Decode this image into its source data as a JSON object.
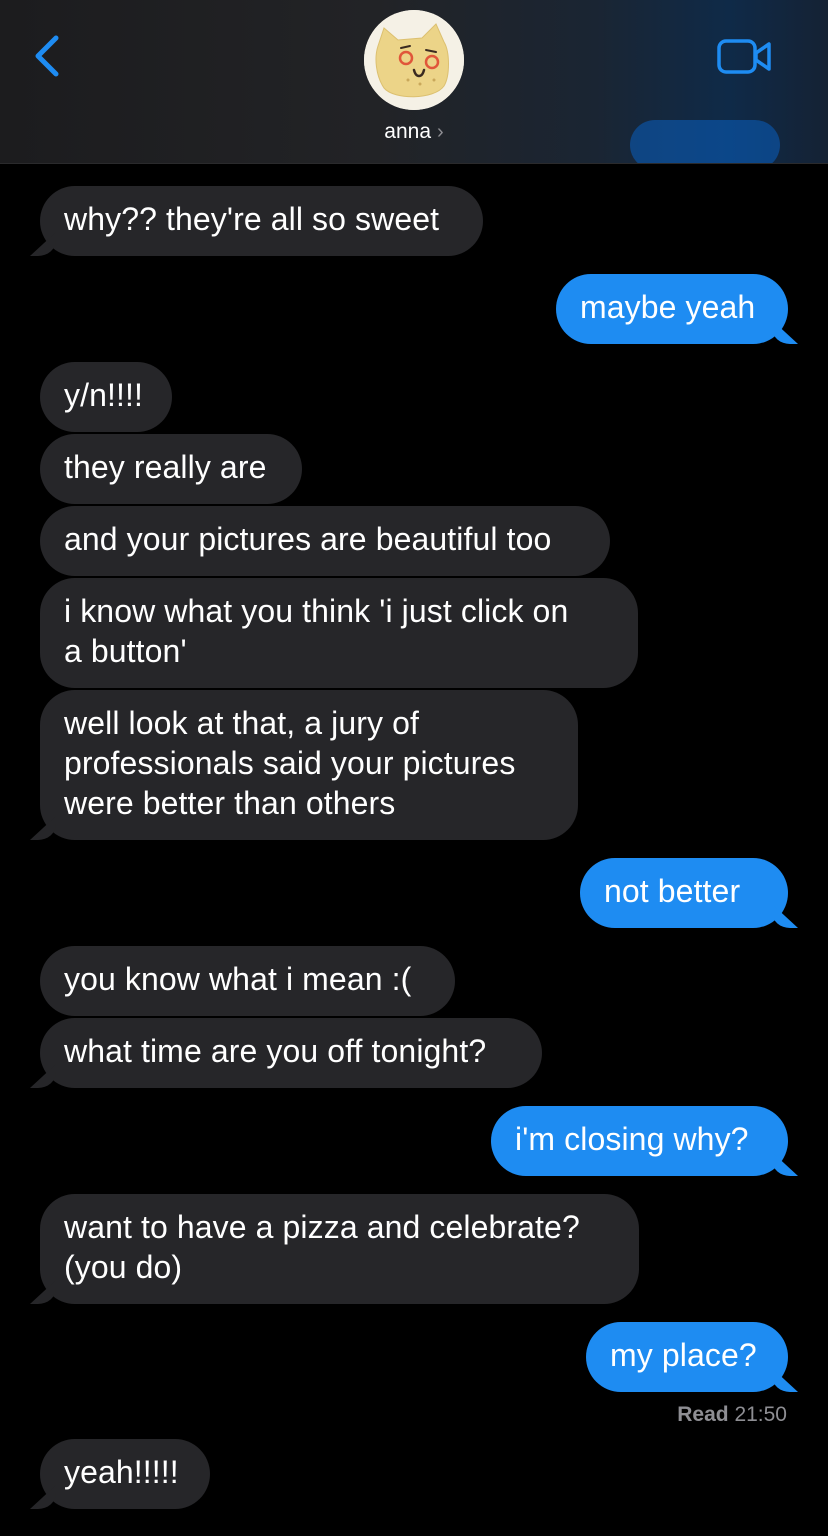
{
  "header": {
    "contact_name": "anna",
    "chevron": "›",
    "icons": {
      "back": "chevron-left-icon",
      "video": "video-camera-icon",
      "avatar": "cat-avatar"
    },
    "accent_color": "#1e8cf2"
  },
  "messages": [
    {
      "from": "anna",
      "text": "why?? they're all so sweet"
    },
    {
      "from": "me",
      "text": "maybe yeah"
    },
    {
      "from": "anna",
      "text": "y/n!!!!"
    },
    {
      "from": "anna",
      "text": "they really are"
    },
    {
      "from": "anna",
      "text": "and your pictures are beautiful too"
    },
    {
      "from": "anna",
      "lines": [
        "i know what you think 'i just click on",
        "a button'"
      ]
    },
    {
      "from": "anna",
      "lines": [
        "well look at that, a jury of",
        "professionals said your pictures",
        "were better than others"
      ]
    },
    {
      "from": "me",
      "text": "not better"
    },
    {
      "from": "anna",
      "text": "you know what i mean :("
    },
    {
      "from": "anna",
      "text": "what time are you off tonight?"
    },
    {
      "from": "me",
      "text": "i'm closing why?"
    },
    {
      "from": "anna",
      "lines": [
        "want to have a pizza and celebrate?",
        "(you do)"
      ]
    },
    {
      "from": "me",
      "text": "my place?"
    },
    {
      "from": "anna",
      "text": "yeah!!!!!"
    }
  ],
  "read_receipt": {
    "label": "Read",
    "time": "21:50"
  },
  "colors": {
    "received_bubble": "#262629",
    "sent_bubble": "#1e8cf2",
    "background": "#000000"
  }
}
